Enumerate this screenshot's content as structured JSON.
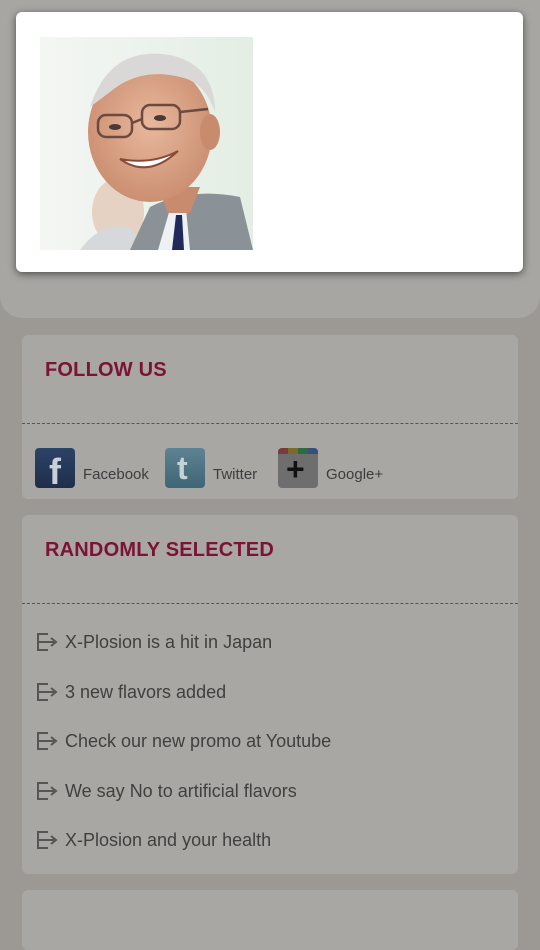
{
  "follow": {
    "title": "FOLLOW US",
    "links": [
      {
        "label": "Facebook",
        "icon": "facebook-icon"
      },
      {
        "label": "Twitter",
        "icon": "twitter-icon"
      },
      {
        "label": "Google+",
        "icon": "google-plus-icon"
      }
    ]
  },
  "random": {
    "title": "RANDOMLY SELECTED",
    "items": [
      {
        "label": "X-Plosion is a hit in Japan"
      },
      {
        "label": "3 new flavors added"
      },
      {
        "label": "Check our new promo at Youtube"
      },
      {
        "label": "We say No to artificial flavors"
      },
      {
        "label": "X-Plosion and your health"
      }
    ]
  },
  "modal": {
    "image": "portrait-photo"
  },
  "colors": {
    "accent": "#7a1335",
    "overlay": "#9c9994"
  }
}
